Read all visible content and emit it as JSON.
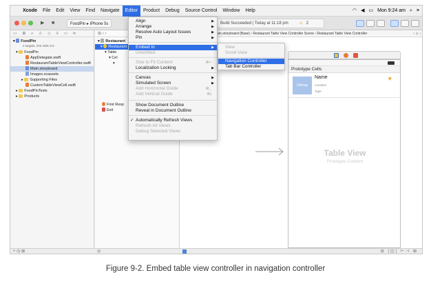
{
  "menubar": {
    "app_name": "Xcode",
    "items": [
      "File",
      "Edit",
      "View",
      "Find",
      "Navigate",
      "Editor",
      "Product",
      "Debug",
      "Source Control",
      "Window",
      "Help"
    ],
    "active_item": "Editor",
    "clock": "Mon 9:24 am"
  },
  "toolbar": {
    "scheme": "FoodPin",
    "device": "iPhone 5s",
    "status_text": "Build Succeeded | Today at 11:18 pm",
    "warning_count": "2"
  },
  "navigator": {
    "project_name": "FoodPin",
    "project_subtitle": "2 targets, iOS SDK 9.0",
    "items": [
      {
        "label": "FoodPin",
        "type": "folder"
      },
      {
        "label": "AppDelegate.swift",
        "type": "swift"
      },
      {
        "label": "RestaurantTableViewController.swift",
        "type": "swift"
      },
      {
        "label": "Main.storyboard",
        "type": "storyboard"
      },
      {
        "label": "Images.xcassets",
        "type": "assets"
      },
      {
        "label": "Supporting Files",
        "type": "folder"
      },
      {
        "label": "CustomTableViewCell.swift",
        "type": "swift"
      },
      {
        "label": "FoodPinTests",
        "type": "folder"
      },
      {
        "label": "Products",
        "type": "folder"
      }
    ]
  },
  "outline": {
    "scene_title": "Restaurant",
    "rows": [
      "Restaurant",
      "Table",
      "Cel",
      "",
      "First Resp",
      "Exit"
    ]
  },
  "jumpbar": {
    "crumbs": [
      "Main.storyboard (Base)",
      "Restaurant Table View Controller Scene",
      "Restaurant Table View Controller"
    ]
  },
  "editor_menu": {
    "items": [
      {
        "label": "Align",
        "submenu": true
      },
      {
        "label": "Arrange",
        "submenu": true
      },
      {
        "label": "Resolve Auto Layout Issues",
        "submenu": true
      },
      {
        "label": "Pin",
        "submenu": true
      },
      {
        "label": "Embed In",
        "submenu": true,
        "highlighted": true
      },
      {
        "label": "Unembed",
        "disabled": true
      },
      {
        "label": "Size to Fit Content",
        "disabled": true,
        "shortcut": "⌘="
      },
      {
        "label": "Localization Locking",
        "submenu": true
      },
      {
        "label": "Canvas",
        "submenu": true
      },
      {
        "label": "Simulated Screen",
        "submenu": true
      },
      {
        "label": "Add Horizontal Guide",
        "disabled": true,
        "shortcut": "⌘_"
      },
      {
        "label": "Add Vertical Guide",
        "disabled": true,
        "shortcut": "⌘|"
      },
      {
        "label": "Show Document Outline"
      },
      {
        "label": "Reveal in Document Outline"
      },
      {
        "label": "Automatically Refresh Views",
        "checked": true
      },
      {
        "label": "Refresh All Views",
        "disabled": true
      },
      {
        "label": "Debug Selected Views",
        "disabled": true
      }
    ]
  },
  "embed_submenu": {
    "items": [
      {
        "label": "View",
        "disabled": true
      },
      {
        "label": "Scroll View",
        "disabled": true
      },
      {
        "label": "Navigation Controller",
        "highlighted": true
      },
      {
        "label": "Tab Bar Controller"
      }
    ]
  },
  "scene": {
    "section_title": "Prototype Cells",
    "cell_title": "Name",
    "cell_subtitle_1": "Location",
    "cell_subtitle_2": "Type",
    "thumbnail_label": "Uitmag",
    "placeholder_title": "Table View",
    "placeholder_subtitle": "Prototype Content"
  },
  "caption": "Figure 9-2. Embed table view controller in navigation controller",
  "colors": {
    "selection_blue": "#2f6ee6",
    "folder_yellow": "#f3c84b",
    "swift_orange": "#e77d3a"
  }
}
